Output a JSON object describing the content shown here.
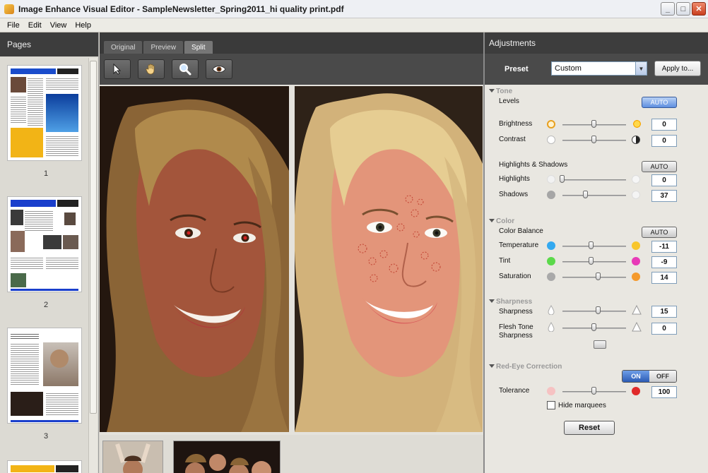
{
  "window": {
    "title": "Image Enhance Visual Editor - SampleNewsletter_Spring2011_hi quality print.pdf",
    "buttons": {
      "minimize": "_",
      "maximize": "□",
      "close": "✕"
    }
  },
  "menu": {
    "items": [
      "File",
      "Edit",
      "View",
      "Help"
    ]
  },
  "pages_panel": {
    "title": "Pages",
    "pages": [
      {
        "number": "1"
      },
      {
        "number": "2"
      },
      {
        "number": "3"
      }
    ]
  },
  "viewer": {
    "tabs": [
      {
        "label": "Original",
        "active": false
      },
      {
        "label": "Preview",
        "active": false
      },
      {
        "label": "Split",
        "active": true
      }
    ],
    "tools": [
      {
        "icon": "arrow-pointer-icon"
      },
      {
        "icon": "hand-icon"
      },
      {
        "icon": "magnifier-icon"
      },
      {
        "icon": "eye-icon"
      }
    ]
  },
  "adjustments": {
    "title": "Adjustments",
    "preset": {
      "label": "Preset",
      "value": "Custom",
      "apply_label": "Apply to..."
    },
    "tone": {
      "title": "Tone",
      "levels_label": "Levels",
      "levels_auto": "AUTO",
      "brightness": {
        "label": "Brightness",
        "value": "0",
        "level": 0.5
      },
      "contrast": {
        "label": "Contrast",
        "value": "0",
        "level": 0.5
      },
      "hs_label": "Highlights & Shadows",
      "hs_auto": "AUTO",
      "highlights": {
        "label": "Highlights",
        "value": "0",
        "level": 0.0
      },
      "shadows": {
        "label": "Shadows",
        "value": "37",
        "level": 0.37
      }
    },
    "color": {
      "title": "Color",
      "balance_label": "Color Balance",
      "balance_auto": "AUTO",
      "temperature": {
        "label": "Temperature",
        "value": "-11",
        "level": 0.45
      },
      "tint": {
        "label": "Tint",
        "value": "-9",
        "level": 0.45
      },
      "saturation": {
        "label": "Saturation",
        "value": "14",
        "level": 0.57
      }
    },
    "sharpness": {
      "title": "Sharpness",
      "sharpness": {
        "label": "Sharpness",
        "value": "15",
        "level": 0.57
      },
      "flesh_tone_line1": "Flesh Tone",
      "flesh_tone_line2": "Sharpness",
      "flesh_value": "0",
      "flesh_level": 0.5
    },
    "redeye": {
      "title": "Red-Eye Correction",
      "on_label": "ON",
      "off_label": "OFF",
      "tolerance": {
        "label": "Tolerance",
        "value": "100",
        "level": 0.5
      },
      "hide_marquees": "Hide marquees"
    },
    "reset_label": "Reset"
  },
  "colors": {
    "panel_dark": "#3d3d3d",
    "auto_active": "#5e8fe0",
    "temperature_cold": "#33a9f0",
    "temperature_warm": "#f8c62c",
    "tint_green": "#5bd94a",
    "tint_magenta": "#e83ab8",
    "saturation_gray": "#a9a9a9",
    "saturation_orange": "#f59a2c"
  }
}
